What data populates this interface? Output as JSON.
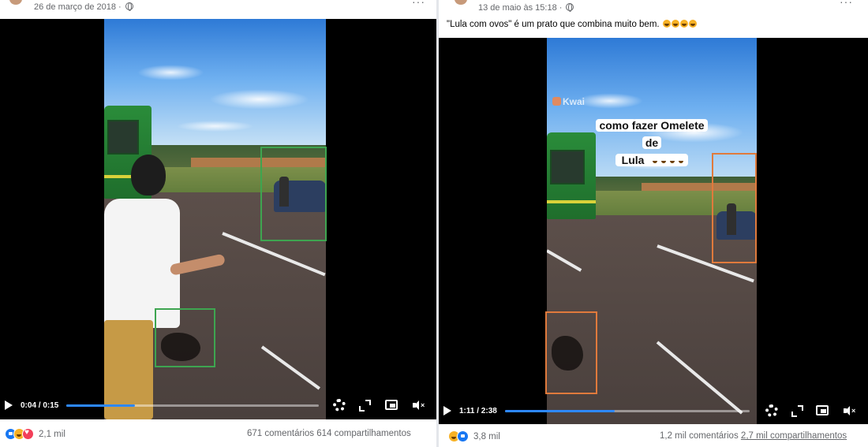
{
  "left_post": {
    "date": "26 de março de 2018 ·",
    "more_icon": "more-horizontal-icon",
    "video": {
      "time": "0:04 / 0:15",
      "progress": 0.27
    },
    "reactions": [
      "like",
      "haha",
      "love"
    ],
    "reaction_count": "2,1 mil",
    "comments": "671 comentários",
    "shares": "614 compartilhamentos"
  },
  "right_post": {
    "date": "13 de maio às 15:18 ·",
    "caption": "\"Lula com ovos\" é um prato que combina muito bem.",
    "caption_emojis": 4,
    "video": {
      "overlay_line1": "como fazer Omelete",
      "overlay_line2": "de",
      "overlay_line3": "Lula",
      "watermark": "Kwai",
      "time": "1:11 / 2:38",
      "progress": 0.45
    },
    "reactions": [
      "haha",
      "like"
    ],
    "reaction_count": "3,8 mil",
    "comments": "1,2 mil comentários",
    "shares": "2,7 mil compartilhamentos"
  },
  "colors": {
    "highlight_left": "#3ea550",
    "highlight_right": "#e07a3c",
    "progress_fill": "#2d88ff",
    "text_secondary": "#65676b"
  }
}
